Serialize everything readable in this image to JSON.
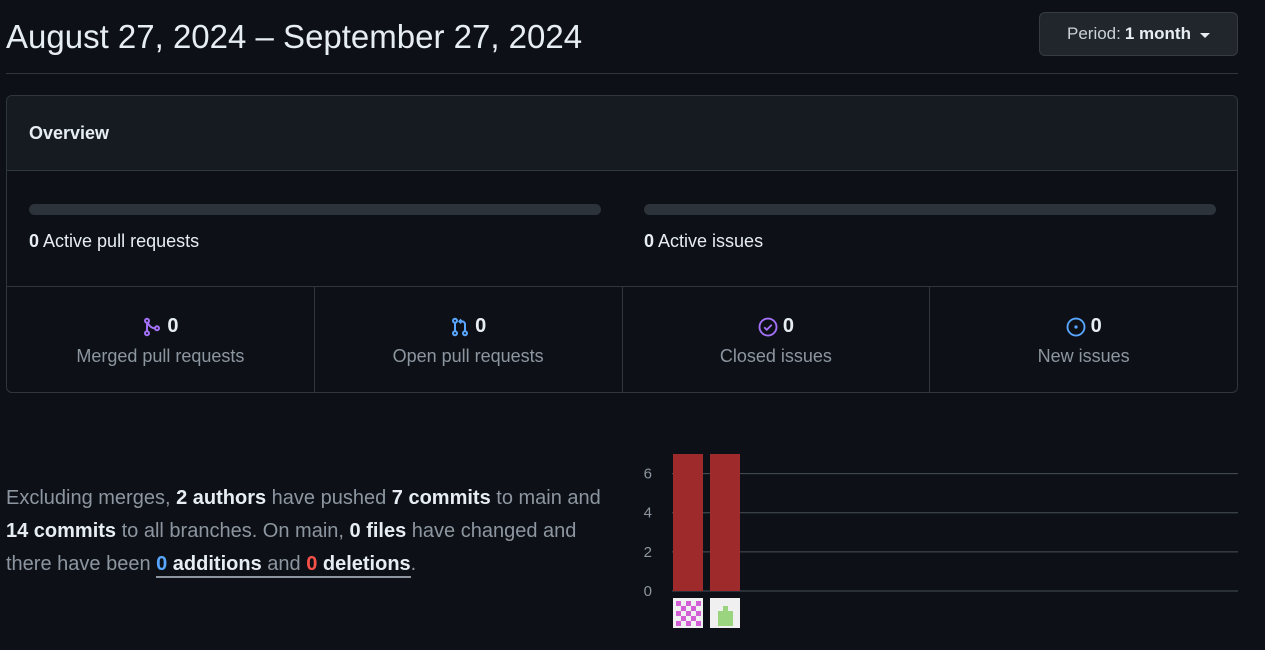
{
  "header": {
    "date_range": "August 27, 2024 – September 27, 2024",
    "period_label": "Period:",
    "period_value": "1 month"
  },
  "overview": {
    "title": "Overview",
    "active_pull_requests": {
      "count": "0",
      "label": "Active pull requests"
    },
    "active_issues": {
      "count": "0",
      "label": "Active issues"
    },
    "stats": [
      {
        "icon": "merged-pr-icon",
        "color": "#a371f7",
        "count": "0",
        "label": "Merged pull requests"
      },
      {
        "icon": "open-pr-icon",
        "color": "#58a6ff",
        "count": "0",
        "label": "Open pull requests"
      },
      {
        "icon": "closed-issue-icon",
        "color": "#a371f7",
        "count": "0",
        "label": "Closed issues"
      },
      {
        "icon": "new-issue-icon",
        "color": "#58a6ff",
        "count": "0",
        "label": "New issues"
      }
    ]
  },
  "summary": {
    "t1": "Excluding merges, ",
    "authors": "2 authors",
    "t2": " have pushed ",
    "commits_main": "7 commits",
    "t3": " to main and ",
    "commits_all": "14 commits",
    "t4": " to all branches. On main, ",
    "files": "0 files",
    "t5": " have changed and there have been ",
    "additions_count": "0",
    "additions_label": " additions",
    "t6": " and ",
    "deletions_count": "0",
    "deletions_label": " deletions",
    "t7": "."
  },
  "chart_data": {
    "type": "bar",
    "categories": [
      "author-1",
      "author-2"
    ],
    "values": [
      7,
      7
    ],
    "ylim": [
      0,
      7
    ],
    "yticks": [
      0,
      2,
      4,
      6
    ],
    "grid": true,
    "bar_color": "#9e2a2b",
    "avatars": [
      {
        "icon": "identicon-pink-avatar",
        "color": "#d25fd6"
      },
      {
        "icon": "identicon-green-avatar",
        "color": "#9bd47e"
      }
    ]
  }
}
